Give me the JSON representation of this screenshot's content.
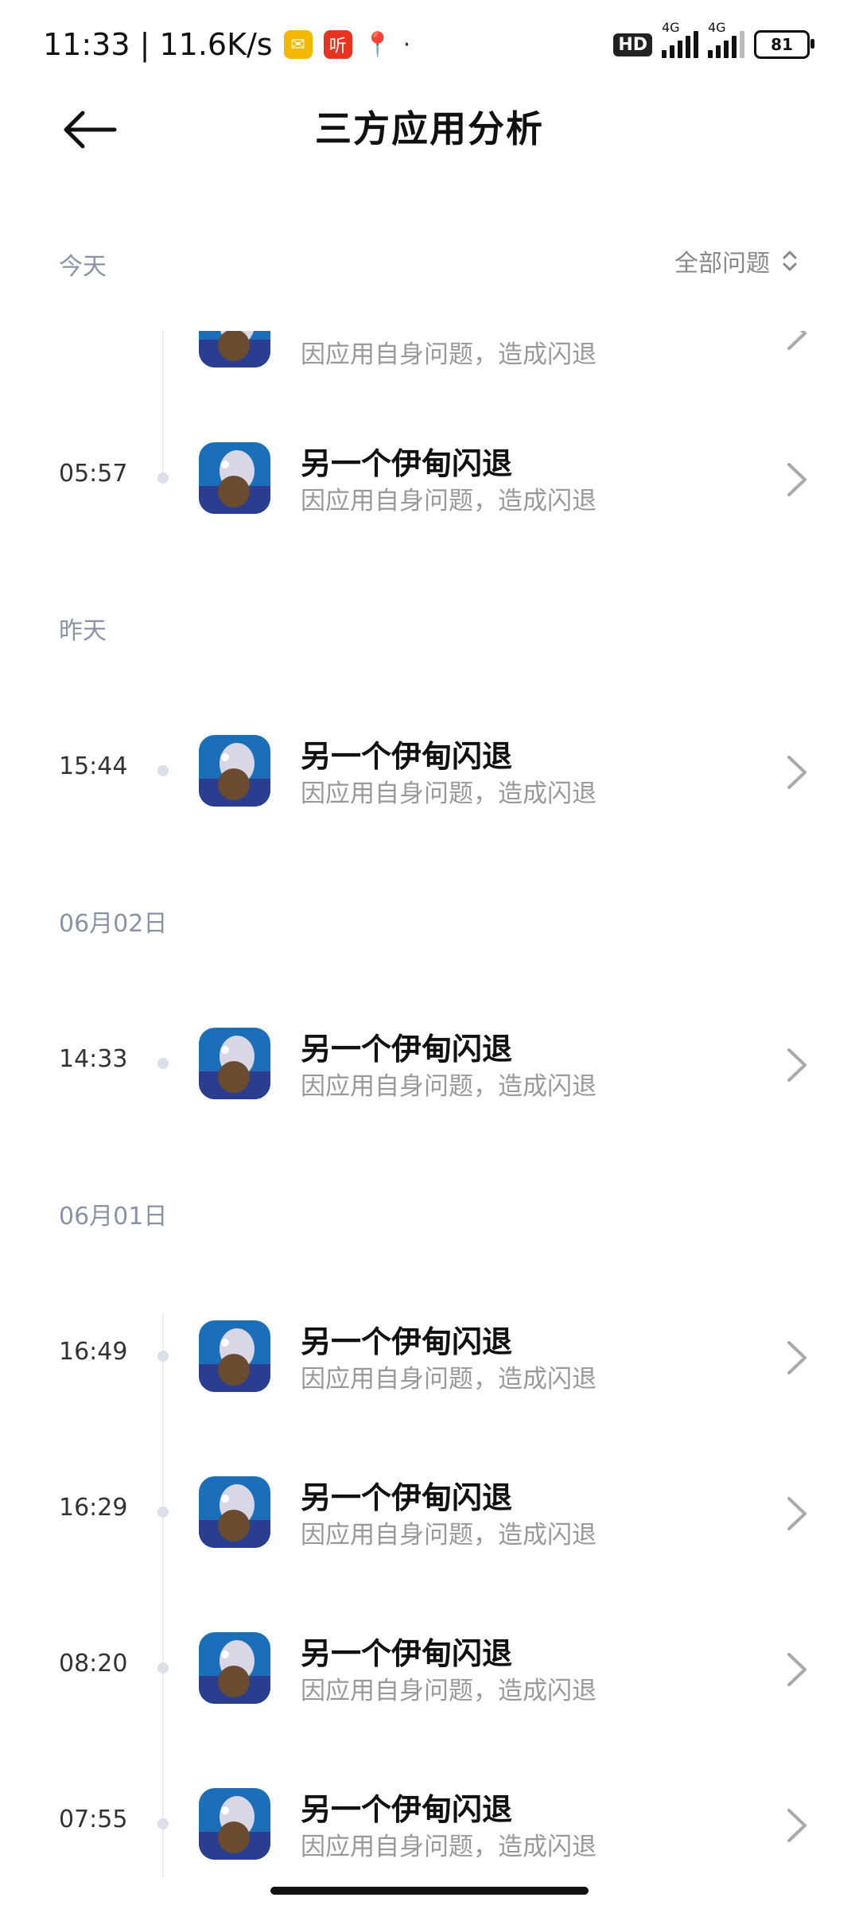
{
  "status_bar": {
    "time_speed": "11:33 | 11.6K/s",
    "notif_mail_icon": "mail-icon",
    "notif_ting_glyph": "听",
    "notif_dot": "·",
    "hd_badge": "HD",
    "network_1": "4G",
    "network_2": "4G",
    "battery": "81"
  },
  "header": {
    "title": "三方应用分析"
  },
  "filter": {
    "label": "全部问题"
  },
  "sections": {
    "today": "今天",
    "yesterday": "昨天",
    "jun02": "06月02日",
    "jun01": "06月01日"
  },
  "rows": [
    {
      "time": "",
      "title": "",
      "subtitle": "因应用自身问题，造成闪退"
    },
    {
      "time": "05:57",
      "title": "另一个伊甸闪退",
      "subtitle": "因应用自身问题，造成闪退"
    },
    {
      "time": "15:44",
      "title": "另一个伊甸闪退",
      "subtitle": "因应用自身问题，造成闪退"
    },
    {
      "time": "14:33",
      "title": "另一个伊甸闪退",
      "subtitle": "因应用自身问题，造成闪退"
    },
    {
      "time": "16:49",
      "title": "另一个伊甸闪退",
      "subtitle": "因应用自身问题，造成闪退"
    },
    {
      "time": "16:29",
      "title": "另一个伊甸闪退",
      "subtitle": "因应用自身问题，造成闪退"
    },
    {
      "time": "08:20",
      "title": "另一个伊甸闪退",
      "subtitle": "因应用自身问题，造成闪退"
    },
    {
      "time": "07:55",
      "title": "另一个伊甸闪退",
      "subtitle": "因应用自身问题，造成闪退"
    }
  ],
  "colors": {
    "accent_label": "#8a93a8",
    "icon_bg": "#1b6fb8"
  }
}
